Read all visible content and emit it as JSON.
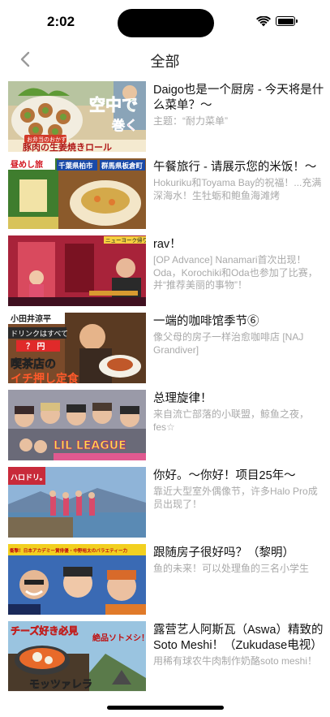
{
  "status_bar": {
    "time": "2:02",
    "battery_level": 1.0
  },
  "nav": {
    "title": "全部",
    "back_icon": "chevron-left-icon"
  },
  "items": [
    {
      "title": "Daigo也是一个厨房 - 今天将是什么菜单？～",
      "subtitle": "主题：“耐力菜单”",
      "thumb_caption": "空中で",
      "thumb_caption2": "巻く",
      "thumb_tag": "お弁当のおかず",
      "thumb_bottom": "豚肉の生姜焼きロール"
    },
    {
      "title": "午餐旅行 - 请展示您的米饭！～",
      "subtitle": "Hokuriku和Toyama Bay的祝福！...充满深海水！生牡蛎和鲍鱼海滩烤",
      "thumb_tag1": "千葉県柏市",
      "thumb_tag2": "群馬県板倉町",
      "thumb_logo": "昼めし旅"
    },
    {
      "title": "rav！",
      "subtitle": "[OP Advance] Nanamari首次出现！Oda，Korochiki和Oda也参加了比赛，并“推荐美丽的事物”！",
      "thumb_tag": "ニューヨーク帰り"
    },
    {
      "title": "一端的咖啡馆季节⑥",
      "subtitle": "像父母的房子一样治愈咖啡店 [NAJ Grandiver]",
      "thumb_name": "小田井涼平",
      "thumb_tag": "ドリンクはすべて",
      "thumb_price": "？ 円",
      "thumb_bottom": "喫茶店の",
      "thumb_bottom2": "イチ押し定食"
    },
    {
      "title": "总理旋律！",
      "subtitle": "来自流亡部落的小联盟，鲸鱼之夜，fes☆",
      "thumb_logo": "LIL LEAGUE"
    },
    {
      "title": "你好。～你好！项目25年～",
      "subtitle": "靠近大型室外偶像节，许多Halo Pro成员出现了！",
      "thumb_logo": "ハロドリ。"
    },
    {
      "title": "跟随房子很好吗？（黎明）",
      "subtitle": "鱼的未来！可以处理鱼的三名小学生",
      "thumb_tag": "衝撃！日本アカデミー賞俳優・中野裕太のバラエティー力"
    },
    {
      "title": "露营艺人阿斯瓦（Aswa）精致的Soto Meshi！（Zukudase电视）",
      "subtitle": "用稀有球农牛肉制作奶酪soto meshi！",
      "thumb_tag": "チーズ好き必見",
      "thumb_tag2": "絶品ソトメシ！",
      "thumb_bottom": "モッツァレラ"
    }
  ]
}
